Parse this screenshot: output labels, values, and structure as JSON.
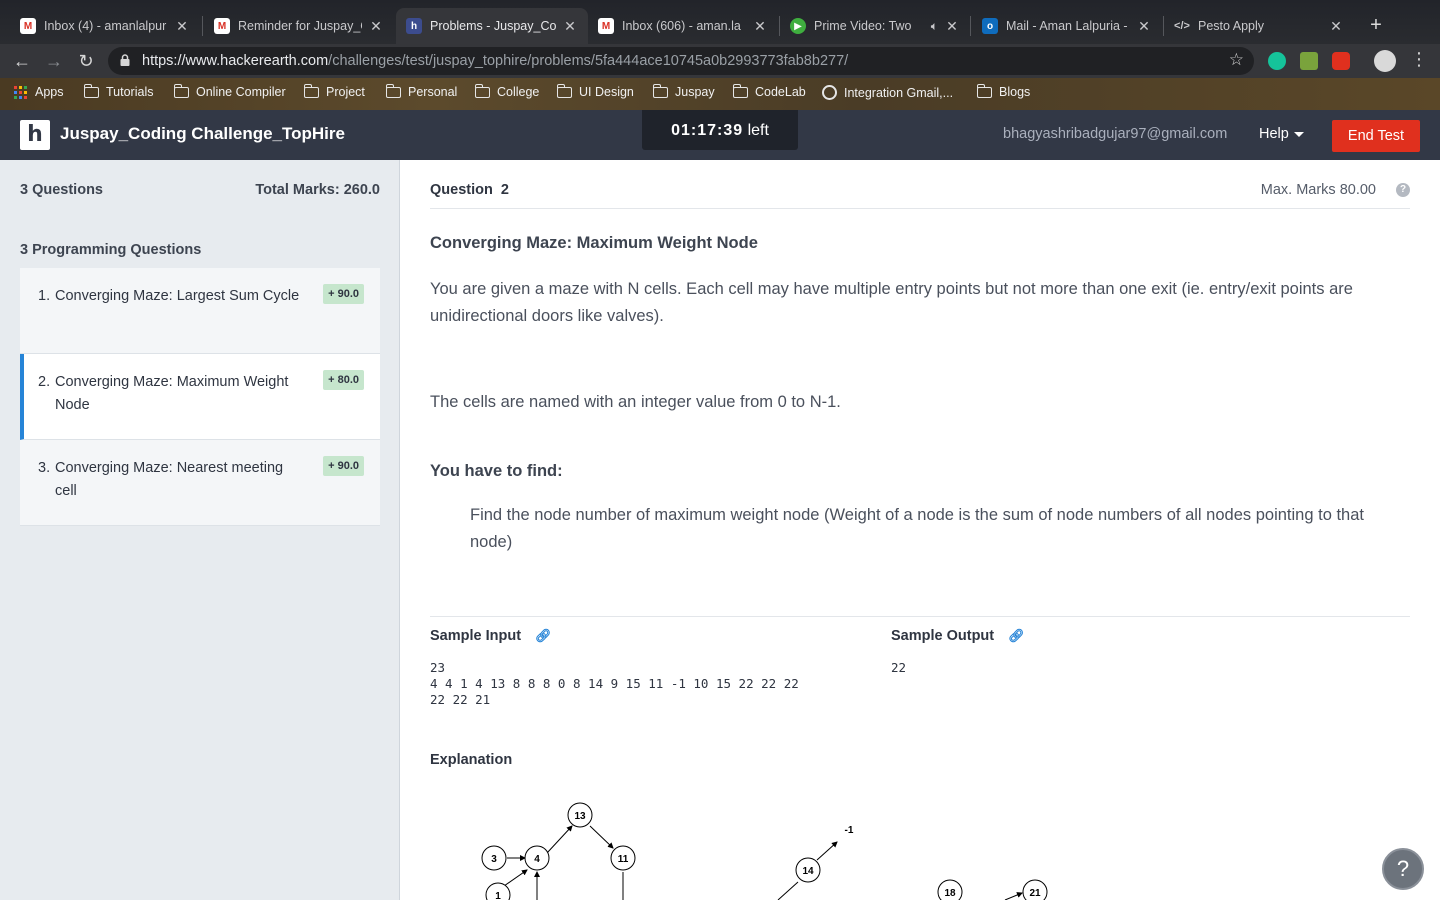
{
  "browser": {
    "tabs": [
      {
        "title": "Inbox (4) - amanlalpur",
        "icon": "gmail-icon",
        "active": false
      },
      {
        "title": "Reminder for Juspay_C",
        "icon": "gmail-icon",
        "active": false
      },
      {
        "title": "Problems - Juspay_Co",
        "icon": "hackerearth-icon",
        "active": true
      },
      {
        "title": "Inbox (606) - aman.la",
        "icon": "gmail-icon",
        "active": false
      },
      {
        "title": "Prime Video: Two",
        "icon": "prime-video-icon",
        "active": false
      },
      {
        "title": "Mail - Aman Lalpuria -",
        "icon": "outlook-icon",
        "active": false
      },
      {
        "title": "Pesto Apply",
        "icon": "code-icon",
        "active": false
      }
    ],
    "url_host": "https://www.hackerearth.com",
    "url_path": "/challenges/test/juspay_tophire/problems/5fa444ace10745a0b2993773fab8b277/",
    "bookmarks": [
      "Apps",
      "Tutorials",
      "Online Compiler",
      "Project",
      "Personal",
      "College",
      "UI Design",
      "Juspay",
      "CodeLab",
      "Integration Gmail,...",
      "Blogs"
    ]
  },
  "header": {
    "logo": "h",
    "title": "Juspay_Coding Challenge_TopHire",
    "timer_value": "01:17:39",
    "timer_suffix": "left",
    "email": "bhagyashribadgujar97@gmail.com",
    "help": "Help",
    "end_test": "End Test"
  },
  "sidebar": {
    "question_count": "3 Questions",
    "total_marks": "Total Marks: 260.0",
    "section_title": "3 Programming Questions",
    "questions": [
      {
        "num": "1.",
        "title": "Converging Maze: Largest Sum Cycle",
        "marks": "+ 90.0",
        "active": false
      },
      {
        "num": "2.",
        "title": "Converging Maze: Maximum Weight Node",
        "marks": "+ 80.0",
        "active": true
      },
      {
        "num": "3.",
        "title": "Converging Maze: Nearest meeting cell",
        "marks": "+ 90.0",
        "active": false
      }
    ]
  },
  "main": {
    "question_label": "Question",
    "question_number": "2",
    "max_marks": "Max. Marks 80.00",
    "problem_title": "Converging Maze: Maximum Weight Node",
    "para1": "You are given a maze with N cells. Each cell may have multiple entry points but not more than one exit (ie. entry/exit points are unidirectional doors like valves).",
    "para2": "The cells are named with an integer value from 0 to N-1.",
    "find_heading": "You have to find:",
    "find_text": "Find the node number of maximum weight node (Weight of a node is the sum of node numbers of all nodes pointing to that node)",
    "sample_input_label": "Sample Input",
    "sample_input": "23\n4 4 1 4 13 8 8 8 0 8 14 9 15 11 -1 10 15 22 22 22\n22 22 21",
    "sample_output_label": "Sample Output",
    "sample_output": "22",
    "explanation_label": "Explanation",
    "graph_nodes": [
      "13",
      "3",
      "4",
      "11",
      "1",
      "14",
      "-1",
      "18",
      "21"
    ]
  },
  "colors": {
    "header_bg": "#323846",
    "end_test": "#e0301e",
    "active_accent": "#2684d7",
    "badge_bg": "#c6e6cd",
    "sidebar_bg": "#e7ebef"
  }
}
